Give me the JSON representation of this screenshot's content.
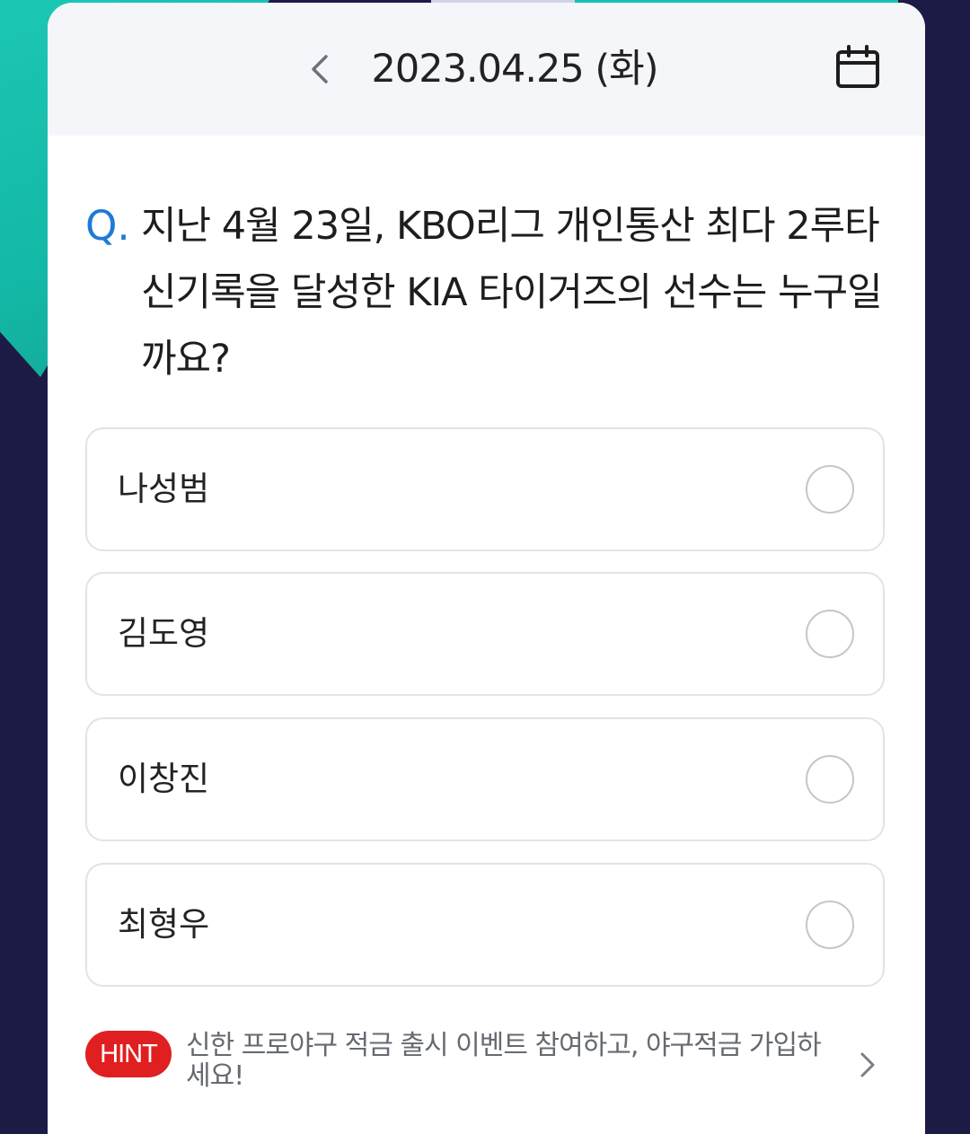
{
  "header": {
    "date": "2023.04.25 (화)",
    "prev_icon": "chevron-left-icon",
    "calendar_icon": "calendar-icon"
  },
  "question": {
    "prefix": "Q.",
    "text": "지난 4월 23일, KBO리그 개인통산 최다 2루타 신기록을 달성한 KIA 타이거즈의 선수는 누구일까요?"
  },
  "options": [
    {
      "label": "나성범",
      "selected": false
    },
    {
      "label": "김도영",
      "selected": false
    },
    {
      "label": "이창진",
      "selected": false
    },
    {
      "label": "최형우",
      "selected": false
    }
  ],
  "hint": {
    "badge": "HINT",
    "text": "신한 프로야구 적금 출시 이벤트 참여하고, 야구적금 가입하세요!",
    "chevron_icon": "chevron-right-icon"
  },
  "colors": {
    "accent_blue": "#1e7ad6",
    "hint_red": "#e02020",
    "background_navy": "#1c1b45",
    "background_teal": "#14b8a6"
  }
}
